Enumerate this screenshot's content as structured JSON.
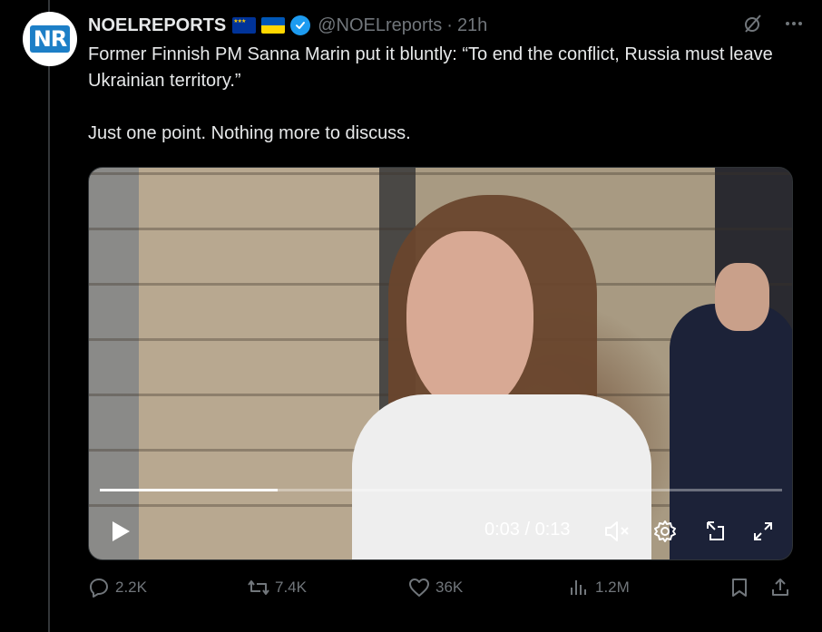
{
  "author": {
    "display_name": "NOELREPORTS",
    "handle": "@NOELreports",
    "separator": "·",
    "time_ago": "21h",
    "avatar_text": "NR"
  },
  "tweet": {
    "line1": "Former Finnish PM Sanna Marin put it bluntly: “To end the conflict, Russia must leave Ukrainian territory.”",
    "line2": "Just one point. Nothing more to discuss."
  },
  "video": {
    "time": "0:03 / 0:13",
    "progress": 0.26
  },
  "actions": {
    "replies": "2.2K",
    "reposts": "7.4K",
    "likes": "36K",
    "views": "1.2M"
  },
  "colors": {
    "background": "#000000",
    "text": "#e7e9ea",
    "muted": "#71767b",
    "verified": "#1d9bf0"
  }
}
